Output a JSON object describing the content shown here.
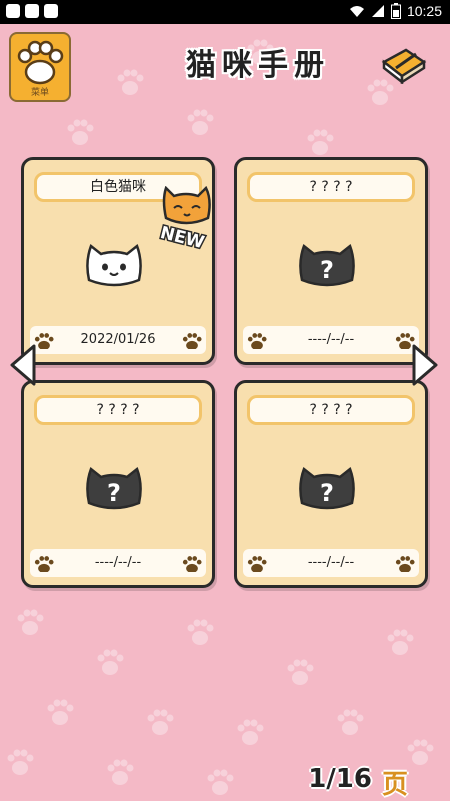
{
  "status_bar": {
    "time": "10:25",
    "icons": [
      "notification-icon",
      "notification-icon",
      "notification-icon",
      "wifi-icon",
      "signal-icon",
      "battery-icon"
    ]
  },
  "header": {
    "menu_label": "菜单",
    "title": "猫咪手册",
    "book_icon": "notebook-pencil-icon"
  },
  "cards": [
    {
      "name": "白色猫咪",
      "date": "2022/01/26",
      "is_new": true,
      "new_label": "NEW",
      "cat": "white-cat-icon"
    },
    {
      "name": "? ? ? ?",
      "date": "----/--/--",
      "is_new": false,
      "cat": "unknown-cat-icon"
    },
    {
      "name": "? ? ? ?",
      "date": "----/--/--",
      "is_new": false,
      "cat": "unknown-cat-icon"
    },
    {
      "name": "? ? ? ?",
      "date": "----/--/--",
      "is_new": false,
      "cat": "unknown-cat-icon"
    }
  ],
  "pagination": {
    "current": "1/16",
    "unit": "页"
  },
  "colors": {
    "background": "#f4b9c6",
    "card": "#f8dfae",
    "accent": "#f5b030"
  }
}
